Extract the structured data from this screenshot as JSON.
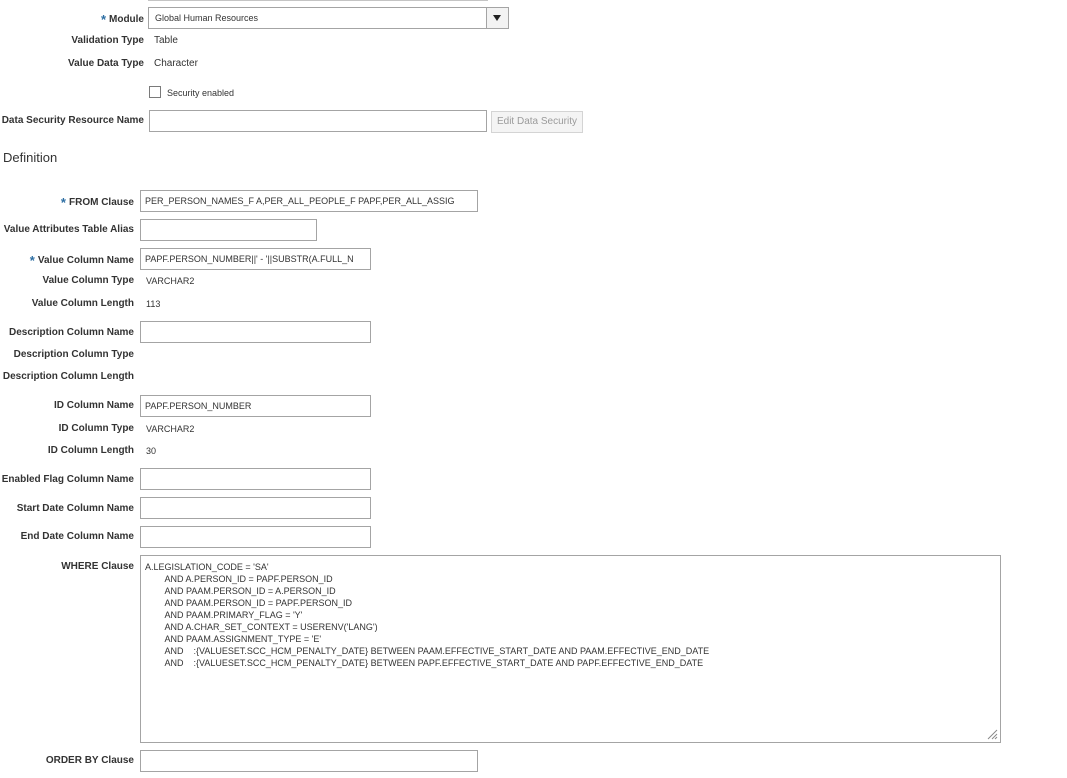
{
  "top": {
    "module_label": "Module",
    "module_value": "Global Human Resources",
    "validation_type_label": "Validation Type",
    "validation_type_value": "Table",
    "value_data_type_label": "Value Data Type",
    "value_data_type_value": "Character",
    "security_enabled_label": "Security enabled",
    "security_enabled": false,
    "data_security_resource_label": "Data Security Resource Name",
    "data_security_resource_value": "",
    "edit_data_security_label": "Edit Data Security"
  },
  "definition": {
    "heading": "Definition",
    "from_clause_label": "FROM Clause",
    "from_clause_value": "PER_PERSON_NAMES_F A,PER_ALL_PEOPLE_F PAPF,PER_ALL_ASSIG",
    "value_attr_alias_label": "Value Attributes Table Alias",
    "value_attr_alias_value": "",
    "value_column_name_label": "Value Column Name",
    "value_column_name_value": "PAPF.PERSON_NUMBER||' - '||SUBSTR(A.FULL_N",
    "value_column_type_label": "Value Column Type",
    "value_column_type_value": "VARCHAR2",
    "value_column_length_label": "Value Column Length",
    "value_column_length_value": "113",
    "description_column_name_label": "Description Column Name",
    "description_column_name_value": "",
    "description_column_type_label": "Description Column Type",
    "description_column_length_label": "Description Column Length",
    "id_column_name_label": "ID Column Name",
    "id_column_name_value": "PAPF.PERSON_NUMBER",
    "id_column_type_label": "ID Column Type",
    "id_column_type_value": "VARCHAR2",
    "id_column_length_label": "ID Column Length",
    "id_column_length_value": "30",
    "enabled_flag_label": "Enabled Flag Column Name",
    "enabled_flag_value": "",
    "start_date_label": "Start Date Column Name",
    "start_date_value": "",
    "end_date_label": "End Date Column Name",
    "end_date_value": "",
    "where_clause_label": "WHERE Clause",
    "where_clause_lines": [
      "A.LEGISLATION_CODE = 'SA'",
      "        AND A.PERSON_ID = PAPF.PERSON_ID",
      "        AND PAAM.PERSON_ID = A.PERSON_ID",
      "        AND PAAM.PERSON_ID = PAPF.PERSON_ID",
      "        AND PAAM.PRIMARY_FLAG = 'Y'",
      "        AND A.CHAR_SET_CONTEXT = USERENV('LANG')",
      "        AND PAAM.ASSIGNMENT_TYPE = 'E'",
      "        AND    :{VALUESET.SCC_HCM_PENALTY_DATE} BETWEEN PAAM.EFFECTIVE_START_DATE AND PAAM.EFFECTIVE_END_DATE",
      "        AND    :{VALUESET.SCC_HCM_PENALTY_DATE} BETWEEN PAPF.EFFECTIVE_START_DATE AND PAPF.EFFECTIVE_END_DATE"
    ],
    "order_by_label": "ORDER BY Clause",
    "order_by_value": ""
  },
  "colors": {
    "required_star": "#2d6ea3",
    "border": "#a4a4a4",
    "disabled_text": "#9b9b9b"
  }
}
